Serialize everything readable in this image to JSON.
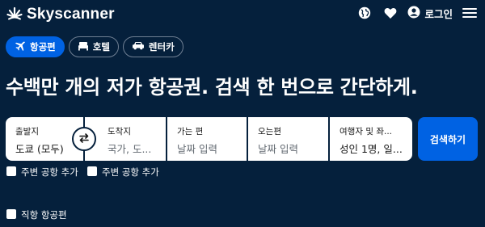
{
  "header": {
    "brand": "Skyscanner",
    "login_label": "로그인",
    "icons": [
      "skyscanner-logo-icon",
      "globe-icon",
      "heart-icon",
      "user-icon",
      "menu-icon"
    ]
  },
  "tabs": [
    {
      "label": "항공편",
      "icon": "airplane-icon",
      "active": true
    },
    {
      "label": "호텔",
      "icon": "bed-icon",
      "active": false
    },
    {
      "label": "렌터카",
      "icon": "car-icon",
      "active": false
    }
  ],
  "headline": "수백만 개의 저가 항공권. 검색 한 번으로 간단하게.",
  "search": {
    "from": {
      "label": "출발지",
      "value": "도쿄 (모두)"
    },
    "to": {
      "label": "도착지",
      "placeholder": "국가, 도..."
    },
    "depart": {
      "label": "가는 편",
      "placeholder": "날짜 입력"
    },
    "return": {
      "label": "오는편",
      "placeholder": "날짜 입력"
    },
    "travelers": {
      "label": "여행자 및 좌...",
      "value": "성인 1명, 일..."
    },
    "button_label": "검색하기"
  },
  "options": {
    "nearby_from": "주변 공항 추가",
    "nearby_to": "주변 공항 추가",
    "direct": "직항 항공편"
  },
  "colors": {
    "background": "#05203c",
    "accent": "#0062e3",
    "text_on_dark": "#ffffff"
  }
}
